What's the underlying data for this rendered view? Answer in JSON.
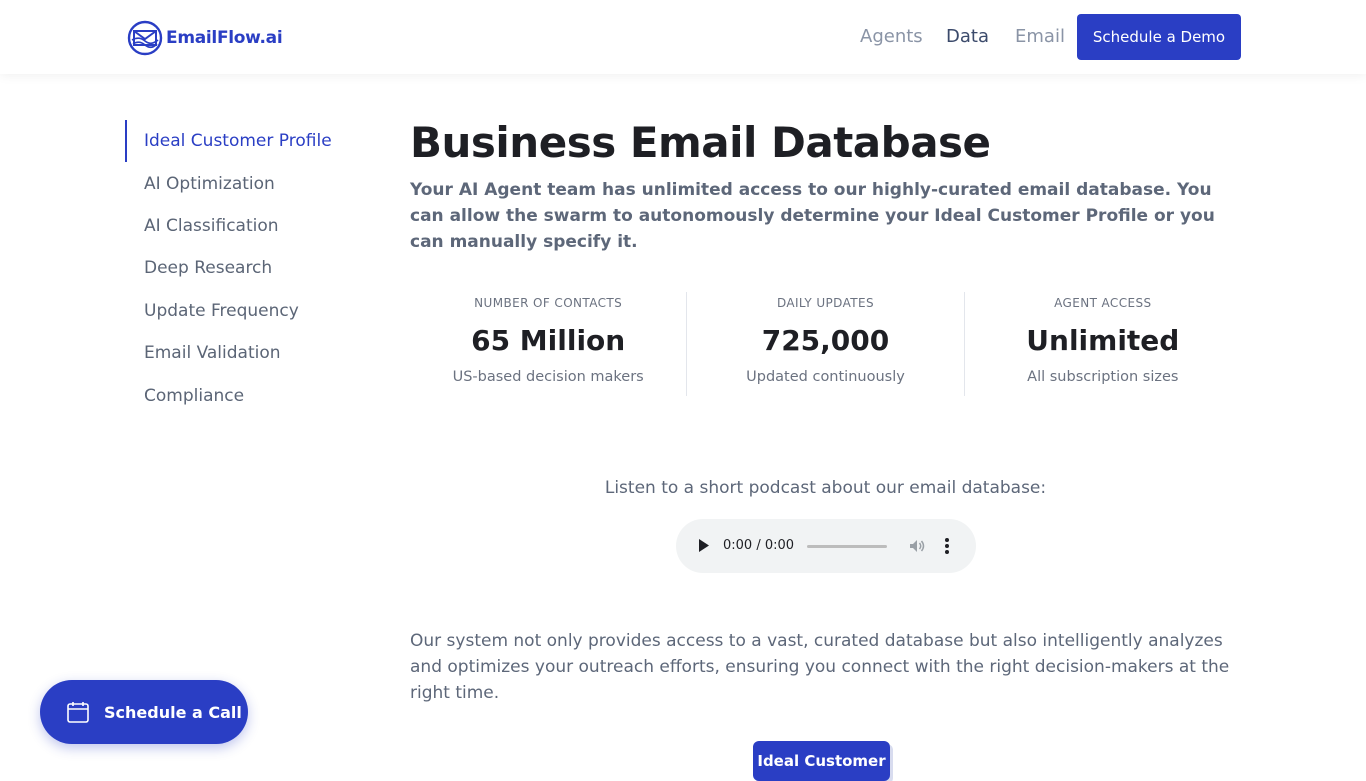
{
  "header": {
    "logo_text": "EmailFlow.ai",
    "nav": [
      "Agents",
      "Data",
      "Email"
    ],
    "cta_label": "Schedule a Demo"
  },
  "sidebar": {
    "items": [
      {
        "label": "Ideal Customer Profile",
        "active": true
      },
      {
        "label": "AI Optimization"
      },
      {
        "label": "AI Classification"
      },
      {
        "label": "Deep Research"
      },
      {
        "label": "Update Frequency"
      },
      {
        "label": "Email Validation"
      },
      {
        "label": "Compliance"
      }
    ]
  },
  "main": {
    "title": "Business Email Database",
    "intro": "Your AI Agent team has unlimited access to our highly-curated email database. You can allow the swarm to autonomously determine your Ideal Customer Profile or you can manually specify it.",
    "stats": [
      {
        "label": "NUMBER OF CONTACTS",
        "value": "65 Million",
        "sub": "US-based decision makers"
      },
      {
        "label": "DAILY UPDATES",
        "value": "725,000",
        "sub": "Updated continuously"
      },
      {
        "label": "AGENT ACCESS",
        "value": "Unlimited",
        "sub": "All subscription sizes"
      }
    ],
    "podcast_prompt": "Listen to a short podcast about our email database:",
    "audio_time": "0:00 / 0:00",
    "body": "Our system not only provides access to a vast, curated database but also intelligently analyzes and optimizes your outreach efforts, ensuring you connect with the right decision-makers at the right time.",
    "diagram_label": "Ideal Customer"
  },
  "floating": {
    "call_label": "Schedule a Call"
  },
  "colors": {
    "brand": "#2a3ec4",
    "text": "#1e1f24",
    "muted": "#5d6779"
  },
  "icons": [
    "logo-envelope-globe-icon",
    "play-icon",
    "volume-icon",
    "more-vertical-icon",
    "calendar-icon"
  ]
}
